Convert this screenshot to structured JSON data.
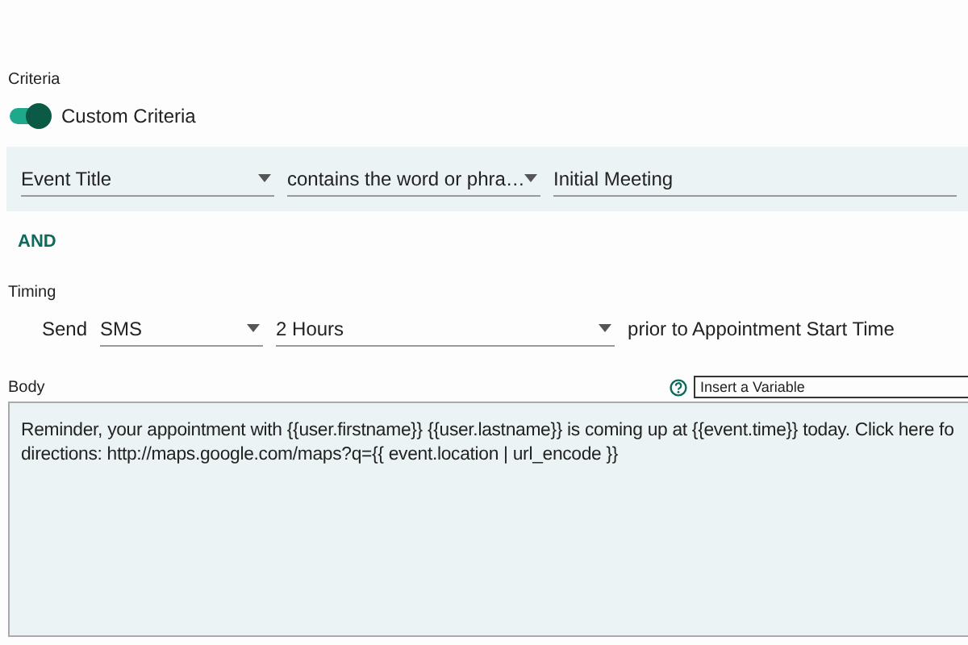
{
  "criteria": {
    "label": "Criteria",
    "toggle": {
      "label": "Custom Criteria",
      "on": true
    },
    "rule": {
      "field": "Event Title",
      "operator": "contains the word or phra…",
      "value": "Initial Meeting"
    },
    "joiner": "AND"
  },
  "timing": {
    "label": "Timing",
    "send_label": "Send",
    "channel": "SMS",
    "offset": "2 Hours",
    "suffix": "prior to Appointment Start Time"
  },
  "body": {
    "label": "Body",
    "variable_select": "Insert a Variable",
    "lines": [
      "Reminder, your appointment with {{user.firstname}} {{user.lastname}} is coming up at {{event.time}} today. Click here fo",
      "directions: http://maps.google.com/maps?q={{ event.location | url_encode }}"
    ]
  }
}
